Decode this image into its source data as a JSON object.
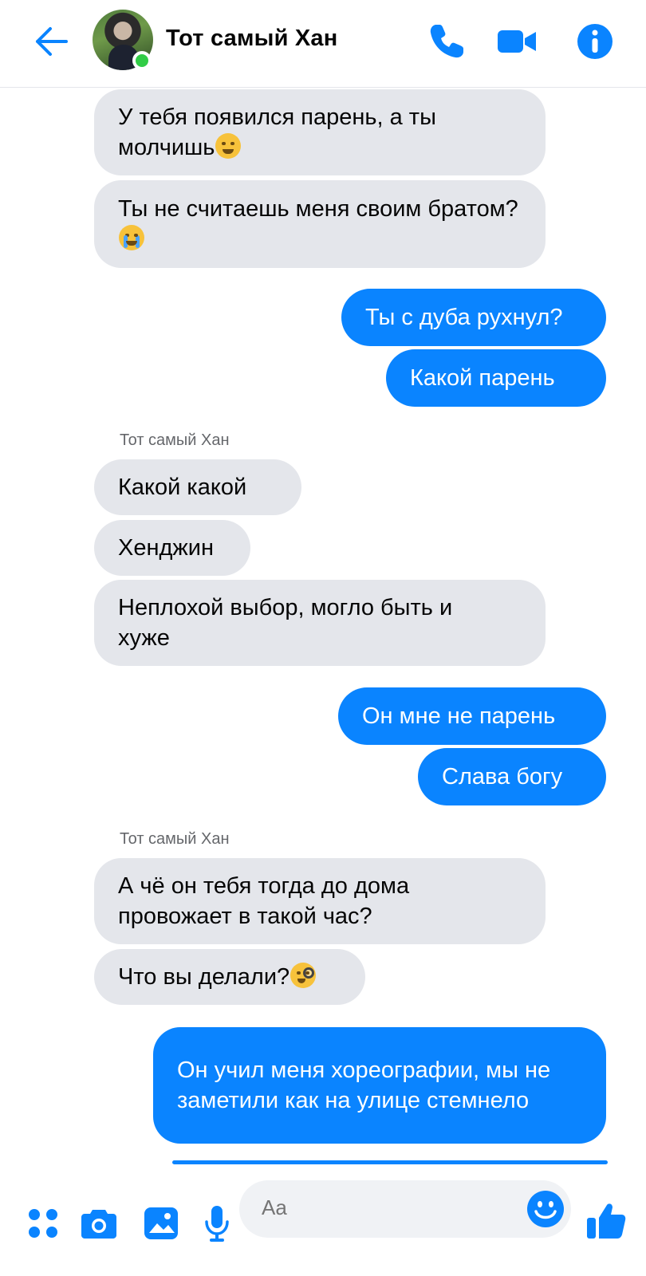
{
  "header": {
    "title": "Тот самый Хан",
    "back_icon": "arrow-left-icon",
    "call_icon": "phone-icon",
    "video_icon": "video-camera-icon",
    "info_icon": "info-icon",
    "accent": "#0a84ff",
    "online_color": "#31cc46"
  },
  "messages": [
    {
      "from": "in",
      "text": "У тебя появился парень, а ты молчишь",
      "emoji": "tired-face-emoji"
    },
    {
      "from": "in",
      "text": "Ты не считаешь меня своим братом?",
      "emoji": "crying-face-emoji"
    },
    {
      "from": "out",
      "text": "Ты с дуба рухнул?"
    },
    {
      "from": "out",
      "text": "Какой парень"
    },
    {
      "from": "label",
      "text": "Тот самый Хан"
    },
    {
      "from": "in",
      "text": "Какой какой"
    },
    {
      "from": "in",
      "text": "Хенджин"
    },
    {
      "from": "in",
      "text": "Неплохой выбор, могло быть и хуже"
    },
    {
      "from": "out",
      "text": "Он мне не парень"
    },
    {
      "from": "out",
      "text": "Слава богу"
    },
    {
      "from": "label",
      "text": "Тот самый Хан"
    },
    {
      "from": "in",
      "text": "А чё он тебя тогда до дома провожает в такой час?"
    },
    {
      "from": "in",
      "text": "Что вы делали?",
      "emoji": "monocle-face-emoji"
    },
    {
      "from": "out",
      "text": "Он учил меня хореографии, мы не заметили как на улице стемнело"
    }
  ],
  "composer": {
    "placeholder": "Aa",
    "icons": [
      "apps-icon",
      "camera-icon",
      "gallery-icon",
      "microphone-icon",
      "emoji-icon",
      "thumbs-up-icon"
    ]
  },
  "colors": {
    "incoming_bubble": "#e4e6eb",
    "outgoing_bubble": "#0a84ff"
  }
}
